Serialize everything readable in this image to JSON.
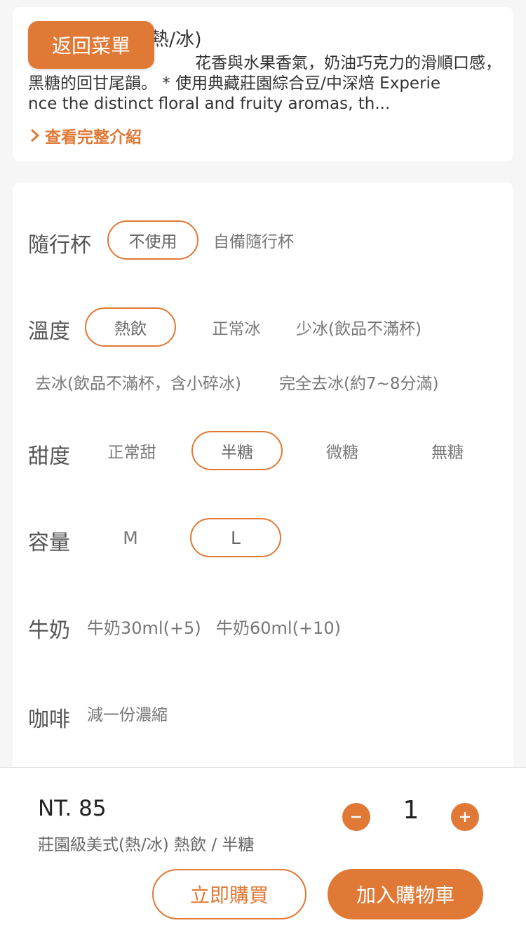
{
  "product": {
    "title_visible": "熱/冰)",
    "desc_line1": "花香與水果香氣，奶油巧克力的滑順口感，",
    "desc_line2": "黑糖的回甘尾韻。 * 使用典藏莊園綜合豆/中深焙 Experie",
    "desc_line3": "nce the distinct floral and fruity aromas, th...",
    "see_more_label": "查看完整介紹"
  },
  "back_button_label": "返回菜單",
  "options": {
    "cup": {
      "label": "隨行杯",
      "choices": [
        "不使用",
        "自備隨行杯"
      ],
      "selected": "不使用"
    },
    "temperature": {
      "label": "溫度",
      "choices": [
        "熱飲",
        "正常冰",
        "少冰(飲品不滿杯)",
        "去冰(飲品不滿杯，含小碎冰)",
        "完全去冰(約7~8分滿)"
      ],
      "selected": "熱飲"
    },
    "sweetness": {
      "label": "甜度",
      "choices": [
        "正常甜",
        "半糖",
        "微糖",
        "無糖"
      ],
      "selected": "半糖"
    },
    "size": {
      "label": "容量",
      "choices": [
        "M",
        "L"
      ],
      "selected": "L"
    },
    "milk": {
      "label": "牛奶",
      "choices": [
        "牛奶30ml(+5)",
        "牛奶60ml(+10)"
      ]
    },
    "coffee": {
      "label": "咖啡",
      "choices": [
        "減一份濃縮"
      ]
    }
  },
  "footer": {
    "price": "NT. 85",
    "summary": "莊園級美式(熱/冰) 熱飲 / 半糖",
    "quantity": "1",
    "buy_now_label": "立即購買",
    "add_cart_label": "加入購物車"
  },
  "colors": {
    "accent": "#e17936"
  },
  "icons": {
    "see_more": "chevron-right-icon",
    "minus": "minus-icon",
    "plus": "plus-icon"
  }
}
